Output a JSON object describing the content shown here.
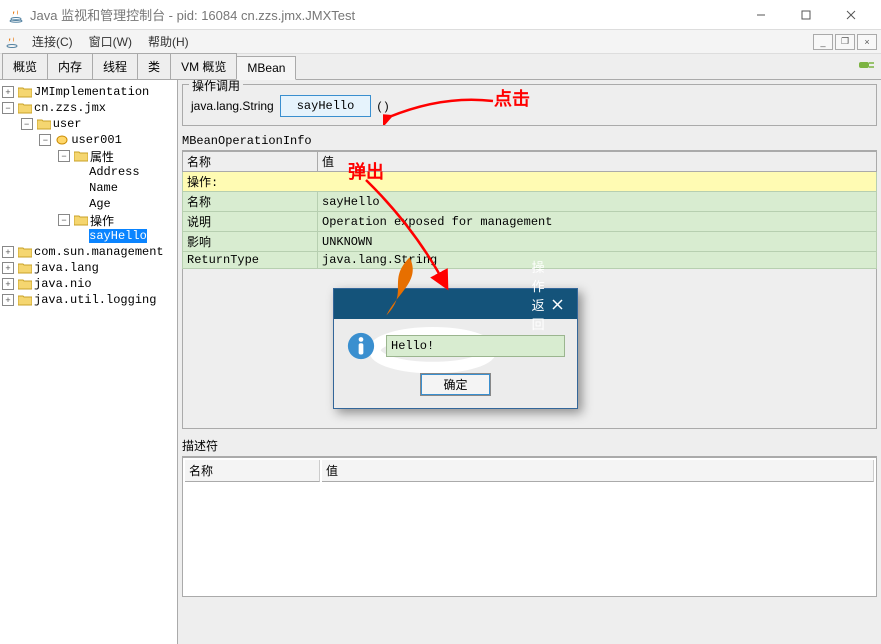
{
  "window": {
    "title": "Java 监视和管理控制台 - pid: 16084 cn.zzs.jmx.JMXTest"
  },
  "menu": {
    "connect": "连接(C)",
    "window": "窗口(W)",
    "help": "帮助(H)"
  },
  "tabs": {
    "overview": "概览",
    "memory": "内存",
    "threads": "线程",
    "classes": "类",
    "vm": "VM 概览",
    "mbean": "MBean"
  },
  "tree": {
    "n0": "JMImplementation",
    "n1": "cn.zzs.jmx",
    "n2": "user",
    "n3": "user001",
    "n4": "属性",
    "n4a": "Address",
    "n4b": "Name",
    "n4c": "Age",
    "n5": "操作",
    "n5a": "sayHello",
    "n6": "com.sun.management",
    "n7": "java.lang",
    "n8": "java.nio",
    "n9": "java.util.logging"
  },
  "op": {
    "group": "操作调用",
    "returnType": "java.lang.String",
    "button": "sayHello",
    "parens": "( )"
  },
  "info": {
    "header": "MBeanOperationInfo",
    "colName": "名称",
    "colValue": "值",
    "rowOp": "操作:",
    "rName": "名称",
    "vName": "sayHello",
    "rDesc": "说明",
    "vDesc": "Operation exposed for management",
    "rImpact": "影响",
    "vImpact": "UNKNOWN",
    "rReturn": "ReturnType",
    "vReturn": "java.lang.String"
  },
  "desc": {
    "header": "描述符",
    "colName": "名称",
    "colValue": "值"
  },
  "dialog": {
    "title": "操作返回值",
    "value": "Hello!",
    "ok": "确定"
  },
  "ann": {
    "click": "点击",
    "popup": "弹出"
  }
}
